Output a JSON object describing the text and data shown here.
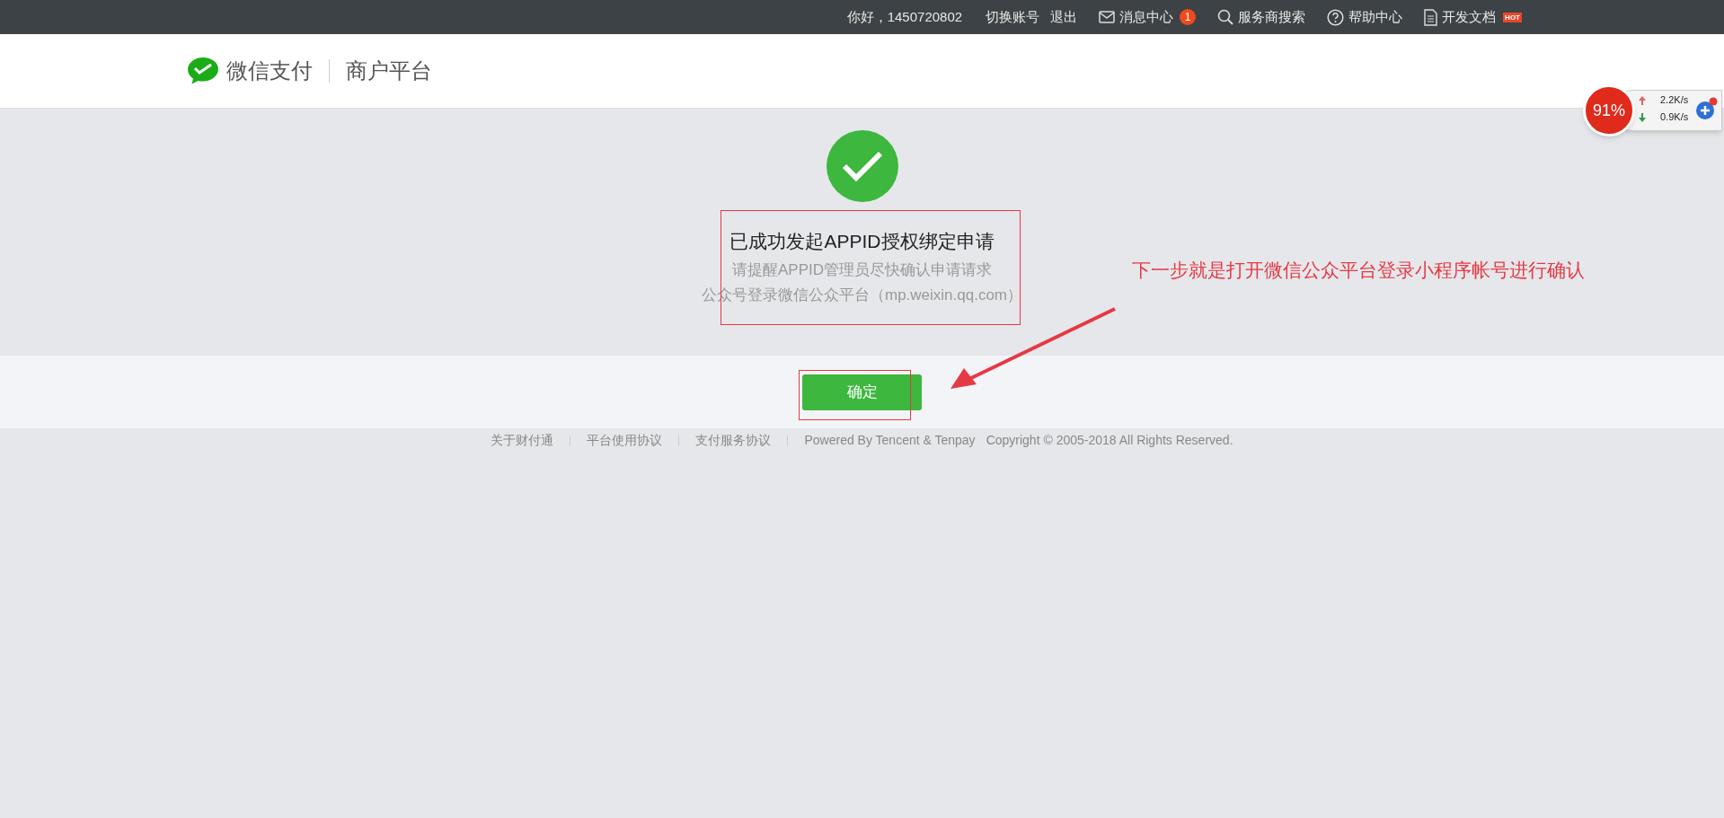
{
  "top_bar": {
    "greeting": "你好，1450720802",
    "links": [
      {
        "kind": "text",
        "label": "切换账号"
      },
      {
        "kind": "text",
        "label": "退出"
      },
      {
        "kind": "mail",
        "label": "消息中心",
        "badge": "1"
      },
      {
        "kind": "search",
        "label": "服务商搜索"
      },
      {
        "kind": "help",
        "label": "帮助中心"
      },
      {
        "kind": "doc",
        "label": "开发文档",
        "tag": "HOT"
      }
    ]
  },
  "header": {
    "brand": "微信支付",
    "product": "商户平台"
  },
  "result": {
    "title": "已成功发起APPID授权绑定申请",
    "lines": [
      "请提醒APPID管理员尽快确认申请请求",
      "公众号登录微信公众平台（mp.weixin.qq.com）"
    ],
    "button": "确定"
  },
  "annotation": {
    "text": "下一步就是打开微信公众平台登录小程序帐号进行确认"
  },
  "footer": {
    "links": [
      "关于财付通",
      "平台使用协议",
      "支付服务协议"
    ],
    "powered": "Powered By Tencent & Tenpay",
    "copyright": "Copyright © 2005-2018 All Rights Reserved."
  },
  "speed_widget": {
    "percent": "91%",
    "upload": "2.2K/s",
    "download": "0.9K/s"
  }
}
